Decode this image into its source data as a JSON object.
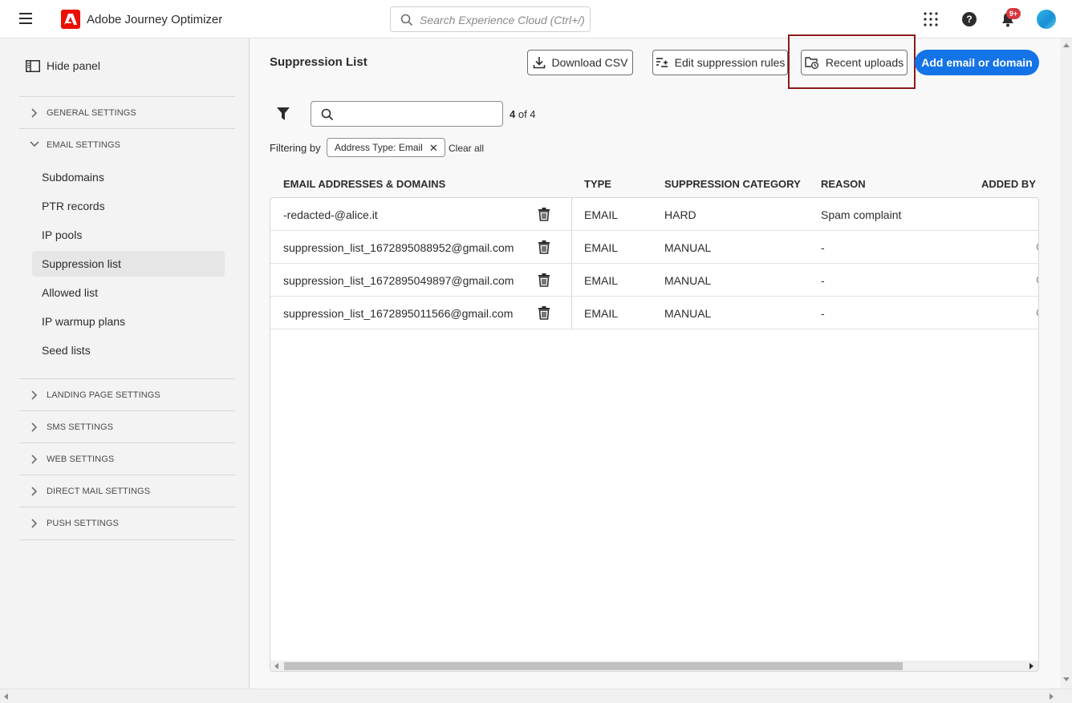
{
  "app": {
    "title": "Adobe Journey Optimizer"
  },
  "header": {
    "search_placeholder": "Search Experience Cloud (Ctrl+/)",
    "notification_count": "9+"
  },
  "sidebar": {
    "hide_panel": "Hide panel",
    "sections": {
      "general": "GENERAL SETTINGS",
      "email": "EMAIL SETTINGS",
      "landing": "LANDING PAGE SETTINGS",
      "sms": "SMS SETTINGS",
      "web": "WEB SETTINGS",
      "direct_mail": "DIRECT MAIL SETTINGS",
      "push": "PUSH SETTINGS"
    },
    "email_items": [
      "Subdomains",
      "PTR records",
      "IP pools",
      "Suppression list",
      "Allowed list",
      "IP warmup plans",
      "Seed lists"
    ],
    "active_item": "Suppression list"
  },
  "main": {
    "title": "Suppression List",
    "buttons": {
      "download_csv": "Download CSV",
      "edit_rules": "Edit suppression rules",
      "recent_uploads": "Recent uploads",
      "add": "Add email or domain"
    },
    "count_current": "4",
    "count_rest": " of 4",
    "filtering_by": "Filtering by",
    "filter_chip": "Address Type: Email",
    "clear_all": "Clear all"
  },
  "table": {
    "headers": {
      "address": "EMAIL ADDRESSES & DOMAINS",
      "type": "TYPE",
      "category": "SUPPRESSION CATEGORY",
      "reason": "REASON",
      "added_by": "ADDED BY"
    },
    "rows": [
      {
        "address": "-redacted-@alice.it",
        "type": "EMAIL",
        "category": "HARD",
        "reason": "Spam complaint"
      },
      {
        "address": "suppression_list_1672895088952@gmail.com",
        "type": "EMAIL",
        "category": "MANUAL",
        "reason": "-"
      },
      {
        "address": "suppression_list_1672895049897@gmail.com",
        "type": "EMAIL",
        "category": "MANUAL",
        "reason": "-"
      },
      {
        "address": "suppression_list_1672895011566@gmail.com",
        "type": "EMAIL",
        "category": "MANUAL",
        "reason": "-"
      }
    ]
  },
  "colors": {
    "accent": "#1473e6",
    "adobe_red": "#eb1000",
    "highlight": "#8b1a1a"
  }
}
